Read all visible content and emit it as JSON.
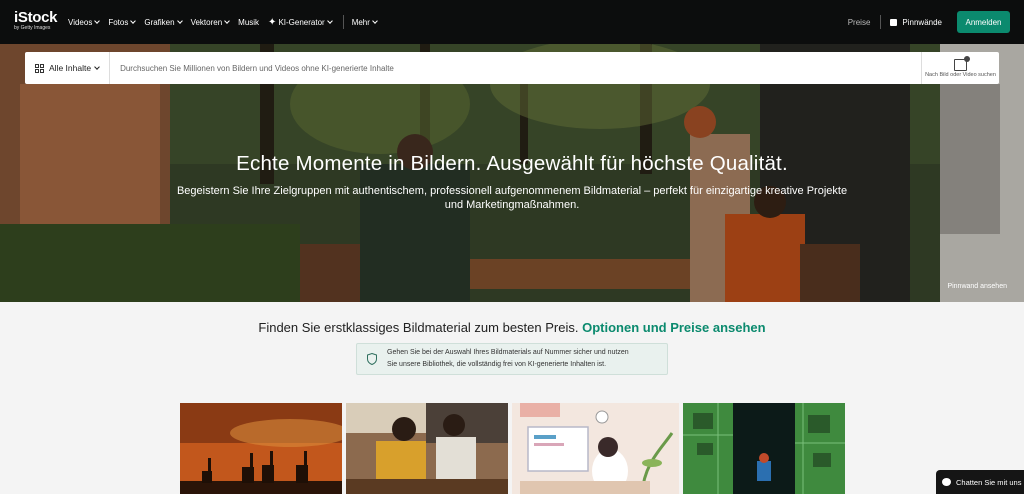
{
  "brand": {
    "logo": "iStock",
    "tagline": "by Getty Images"
  },
  "nav": {
    "items": [
      {
        "label": "Videos",
        "dropdown": true
      },
      {
        "label": "Fotos",
        "dropdown": true
      },
      {
        "label": "Grafiken",
        "dropdown": true
      },
      {
        "label": "Vektoren",
        "dropdown": true
      },
      {
        "label": "Musik",
        "dropdown": false
      },
      {
        "label": "KI-Generator",
        "dropdown": true,
        "icon": "sparkle-icon"
      },
      {
        "label": "Mehr",
        "dropdown": true
      }
    ],
    "pricing": "Preise",
    "boards": "Pinnwände",
    "signin": "Anmelden"
  },
  "search": {
    "filter": "Alle Inhalte",
    "placeholder": "Durchsuchen Sie Millionen von Bildern und Videos ohne KI-generierte Inhalte",
    "image_search_label": "Nach Bild oder Video suchen"
  },
  "hero": {
    "title": "Echte Momente in Bildern. Ausgewählt für höchste Qualität.",
    "subtitle_line1": "Begeistern Sie Ihre Zielgruppen mit authentischem, professionell aufgenommenem Bildmaterial – perfekt für einzigartige kreative Projekte",
    "subtitle_line2": "und Marketingmaßnahmen.",
    "board_link": "Pinnwand ansehen"
  },
  "promo": {
    "text": "Finden Sie erstklassiges Bildmaterial zum besten Preis.",
    "link": "Optionen und Preise ansehen"
  },
  "notice": {
    "line1": "Gehen Sie bei der Auswahl Ihres Bildmaterials auf Nummer sicher und nutzen",
    "line2": "Sie unsere Bibliothek, die vollständig frei von KI-generierte Inhalten ist."
  },
  "chat": {
    "label": "Chatten Sie mit uns"
  },
  "colors": {
    "accent": "#0b8a6e",
    "nav_bg": "#0c0d0d"
  }
}
